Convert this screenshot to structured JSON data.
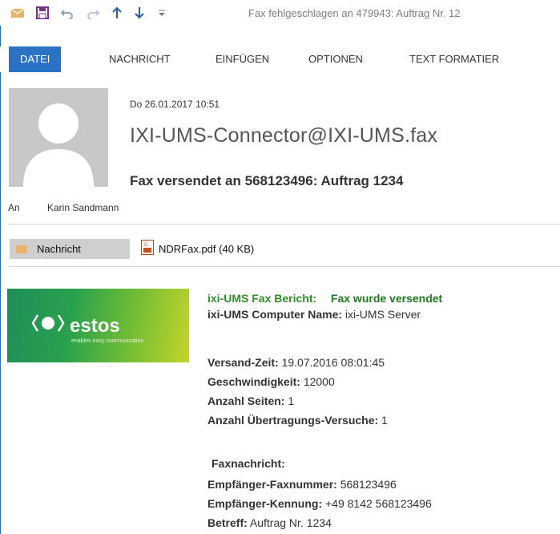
{
  "toolbar": {
    "window_title": "Fax fehlgeschlagen an 479943: Auftrag Nr. 12"
  },
  "ribbon": {
    "tabs": [
      "DATEI",
      "NACHRICHT",
      "EINFÜGEN",
      "OPTIONEN",
      "TEXT FORMATIER"
    ]
  },
  "header": {
    "date": "Do 26.01.2017 10:51",
    "sender": "IXI-UMS-Connector@IXI-UMS.fax",
    "subject": "Fax versendet an 568123496: Auftrag 1234",
    "to_label": "An",
    "to_name": "Karin Sandmann"
  },
  "attachments": {
    "message_label": "Nachricht",
    "file_label": "NDRFax.pdf (40 KB)"
  },
  "logo": {
    "word": "estos",
    "tagline": "enables easy communication"
  },
  "report": {
    "title": "ixi-UMS Fax Bericht:",
    "status": "Fax wurde versendet",
    "computer_label": "ixi-UMS Computer Name:",
    "computer_value": "ixi-UMS Server",
    "send_time_label": "Versand-Zeit:",
    "send_time_value": "19.07.2016 08:01:45",
    "speed_label": "Geschwindigkeit:",
    "speed_value": "12000",
    "pages_label": "Anzahl Seiten:",
    "pages_value": "1",
    "attempts_label": "Anzahl Übertragungs-Versuche:",
    "attempts_value": "1",
    "fax_message_label": "Faxnachricht:",
    "recipient_number_label": "Empfänger-Faxnummer:",
    "recipient_number_value": "568123496",
    "recipient_id_label": "Empfänger-Kennung:",
    "recipient_id_value": "+49 8142 568123496",
    "subject_label": "Betreff:",
    "subject_value": "Auftrag Nr. 1234"
  }
}
